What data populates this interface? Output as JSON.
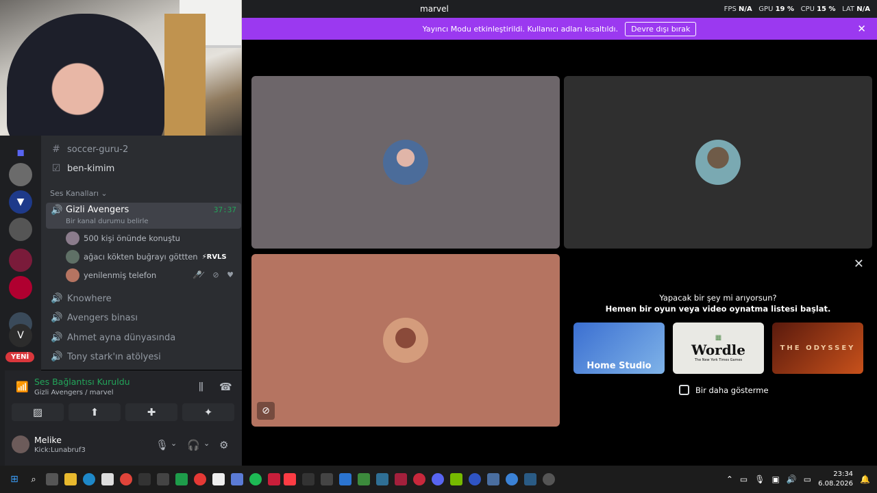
{
  "window": {
    "title": "marvel",
    "stats": {
      "fps_label": "FPS",
      "fps": "N/A",
      "gpu_label": "GPU",
      "gpu": "19 %",
      "cpu_label": "CPU",
      "cpu": "15 %",
      "lat_label": "LAT",
      "lat": "N/A"
    }
  },
  "banner": {
    "text": "Yayıncı Modu etkinleştirildi. Kullanıcı adları kısaltıldı.",
    "button": "Devre dışı bırak",
    "close_icon": "close-icon"
  },
  "guilds": {
    "new_badge": "YENİ"
  },
  "channels": {
    "soccer": "soccer-guru-2",
    "benkimim": "ben-kimim",
    "category": "Ses Kanalları",
    "active": {
      "name": "Gizli Avengers",
      "timer": "37:37",
      "status": "Bir kanal durumu belirle"
    },
    "members": [
      {
        "name": "500 kişi önünde konuştu",
        "tag": ""
      },
      {
        "name": "ağacı kökten buğrayı göttten",
        "tag": "⚡RVLS"
      },
      {
        "name": "yenilenmiş telefon",
        "tag": ""
      }
    ],
    "voice": [
      "Knowhere",
      "Avengers binası",
      "Ahmet ayna dünyasında",
      "Tony stark'ın atölyesi"
    ]
  },
  "voice_panel": {
    "title": "Ses Bağlantısı Kuruldu",
    "sub": "Gizli Avengers / marvel"
  },
  "user": {
    "name": "Melike",
    "status": "Kick:Lunabruf3"
  },
  "activity": {
    "q1": "Yapacak bir şey mi arıyorsun?",
    "q2": "Hemen bir oyun veya video oynatma listesi başlat.",
    "cards": [
      "Home Studio",
      "Wordle",
      "THE ODYSSEY"
    ],
    "wordle_sub": "The New York Times Games",
    "checkbox": "Bir daha gösterme"
  },
  "tiles": {
    "colors": {
      "tile1": "#6d666a",
      "tile2": "#2f2f2f",
      "tile3": "#b57461"
    }
  },
  "taskbar": {
    "time": "23:34",
    "date": "6.08.2026"
  },
  "colors": {
    "accent": "#9b39f0",
    "green": "#23a55a",
    "bg": "#2b2d31"
  }
}
